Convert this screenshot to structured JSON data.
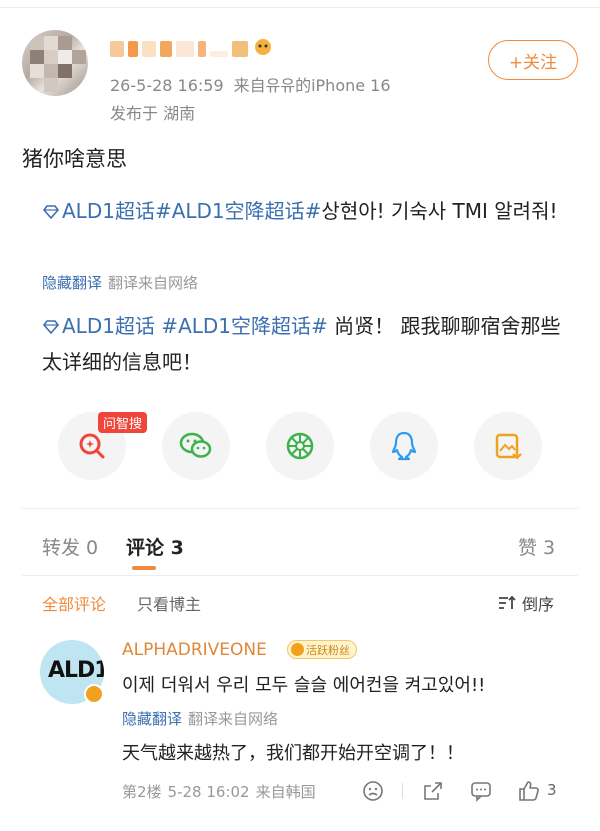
{
  "header": {
    "meta_time": "26-5-28 16:59",
    "meta_source": "来自유유的iPhone 16",
    "location": "发布于 湖南",
    "follow_label": "+关注"
  },
  "post": {
    "text": "猪你啥意思",
    "original": {
      "topics": "ALD1超话#ALD1空降超话#",
      "rest": "상현아! 기숙사 TMI 알려줘!"
    },
    "translate_hide": "隐藏翻译",
    "translate_source": "翻译来自网络",
    "translated": {
      "topics": "ALD1超话 #ALD1空降超话#",
      "rest": " 尚贤！ 跟我聊聊宿舍那些太详细的信息吧！"
    }
  },
  "share": {
    "ai_badge": "问智搜",
    "icons": [
      "ai-search-icon",
      "wechat-icon",
      "moments-icon",
      "qq-icon",
      "save-image-icon"
    ]
  },
  "tabs": {
    "repost": "转发 0",
    "comments": "评论 3",
    "likes": "赞 3"
  },
  "filters": {
    "all": "全部评论",
    "op_only": "只看博主",
    "sort": "倒序"
  },
  "comment": {
    "avatar_text": "ALD1",
    "name": "ALPHADRIVEONE",
    "fan_badge": "活跃粉丝",
    "text": "이제 더워서 우리 모두 슬슬 에어컨을 켜고있어!!",
    "translate_hide": "隐藏翻译",
    "translate_source": "翻译来自网络",
    "translated": "天气越来越热了，我们都开始开空调了！！",
    "floor": "第2楼",
    "time": "5-28 16:02",
    "origin": "来自韩国",
    "like_count": "3"
  },
  "colors": {
    "accent": "#f08a3c",
    "link": "#3b6fb0",
    "muted": "#888888"
  }
}
